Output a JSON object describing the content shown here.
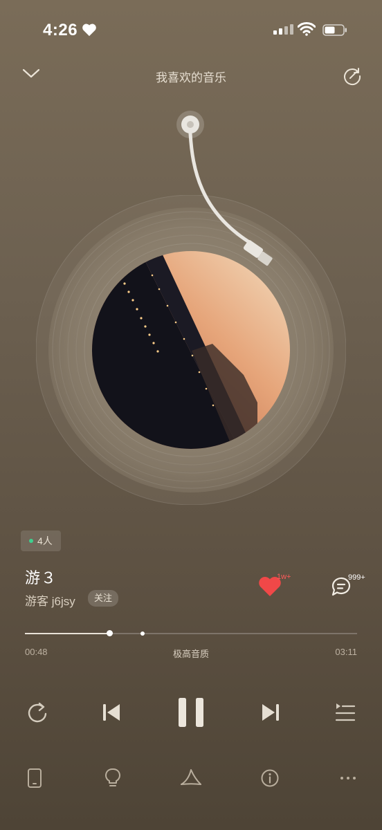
{
  "status_bar": {
    "time": "4:26"
  },
  "header": {
    "title": "我喜欢的音乐"
  },
  "session": {
    "listeners": "4人"
  },
  "song": {
    "title": "游３",
    "artist": "游客 j6jsy",
    "follow_label": "关注"
  },
  "stats": {
    "likes": "1w+",
    "comments": "999+",
    "liked": true
  },
  "progress": {
    "current": "00:48",
    "total": "03:11",
    "quality": "极高音质",
    "fraction": 0.255,
    "cached_fraction": 0.355
  },
  "colors": {
    "accent_like": "#f04848",
    "listener_dot": "#3ed08f",
    "background": "#6c6050"
  },
  "icons": {
    "header": [
      "chevron-down-icon",
      "share-icon"
    ],
    "controls": [
      "repeat-icon",
      "previous-icon",
      "pause-icon",
      "next-icon",
      "playlist-icon"
    ],
    "bottom_bar": [
      "device-icon",
      "lightbulb-icon",
      "sound-effect-icon",
      "info-icon",
      "more-icon"
    ]
  }
}
